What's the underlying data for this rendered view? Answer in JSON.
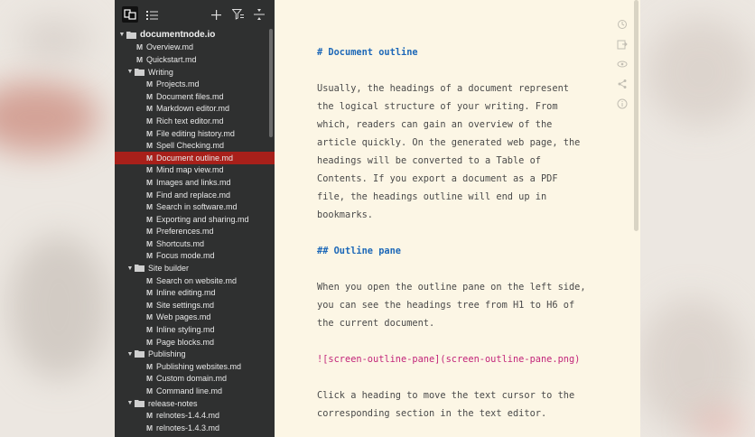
{
  "sidebar": {
    "toolbar": {
      "files_icon": "files-icon",
      "outline_icon": "list-icon",
      "add_icon": "plus-icon",
      "filter_icon": "filter-icon",
      "collapse_icon": "collapse-icon"
    },
    "root": {
      "label": "documentnode.io"
    },
    "items": [
      {
        "label": "Overview.md"
      },
      {
        "label": "Quickstart.md"
      }
    ],
    "folders": [
      {
        "label": "Writing",
        "files": [
          {
            "label": "Projects.md"
          },
          {
            "label": "Document files.md"
          },
          {
            "label": "Markdown editor.md"
          },
          {
            "label": "Rich text editor.md"
          },
          {
            "label": "File editing history.md"
          },
          {
            "label": "Spell Checking.md"
          },
          {
            "label": "Document outline.md"
          },
          {
            "label": "Mind map view.md"
          },
          {
            "label": "Images and links.md"
          },
          {
            "label": "Find and replace.md"
          },
          {
            "label": "Search in software.md"
          },
          {
            "label": "Exporting and sharing.md"
          },
          {
            "label": "Preferences.md"
          },
          {
            "label": "Shortcuts.md"
          },
          {
            "label": "Focus mode.md"
          }
        ]
      },
      {
        "label": "Site builder",
        "files": [
          {
            "label": "Search on website.md"
          },
          {
            "label": "Inline editing.md"
          },
          {
            "label": "Site settings.md"
          },
          {
            "label": "Web pages.md"
          },
          {
            "label": "Inline styling.md"
          },
          {
            "label": "Page blocks.md"
          }
        ]
      },
      {
        "label": "Publishing",
        "files": [
          {
            "label": "Publishing websites.md"
          },
          {
            "label": "Custom domain.md"
          },
          {
            "label": "Command line.md"
          }
        ]
      },
      {
        "label": "release-notes",
        "files": [
          {
            "label": "relnotes-1.4.4.md"
          },
          {
            "label": "relnotes-1.4.3.md"
          }
        ]
      }
    ],
    "file_marker": "M",
    "selected_item": "Document outline.md"
  },
  "editor": {
    "heading1": "# Document outline",
    "para1": [
      "Usually, the headings of a document represent",
      "the logical structure of your writing. From",
      "which, readers can gain an overview of the",
      "article quickly. On the generated web page, the",
      "headings will be converted to a Table of",
      "Contents. If you export a document as a PDF",
      "file, the headings outline will end up in",
      "bookmarks."
    ],
    "heading2": "## Outline pane",
    "para2": [
      "When you open the outline pane on the left side,",
      "you can see the headings tree from H1 to H6 of",
      "the current document."
    ],
    "image_md": "![screen-outline-pane](screen-outline-pane.png)",
    "para3": [
      "Click a heading to move the text cursor to the",
      "corresponding section in the text editor."
    ],
    "right_icons": [
      "history-icon",
      "export-icon",
      "preview-icon",
      "share-icon",
      "info-icon"
    ]
  },
  "colors": {
    "sidebar_bg": "#2f3030",
    "selected_bg": "#a8201a",
    "editor_bg": "#fcf6e5",
    "heading_color": "#1d68b8",
    "image_link_color": "#c2257a"
  }
}
